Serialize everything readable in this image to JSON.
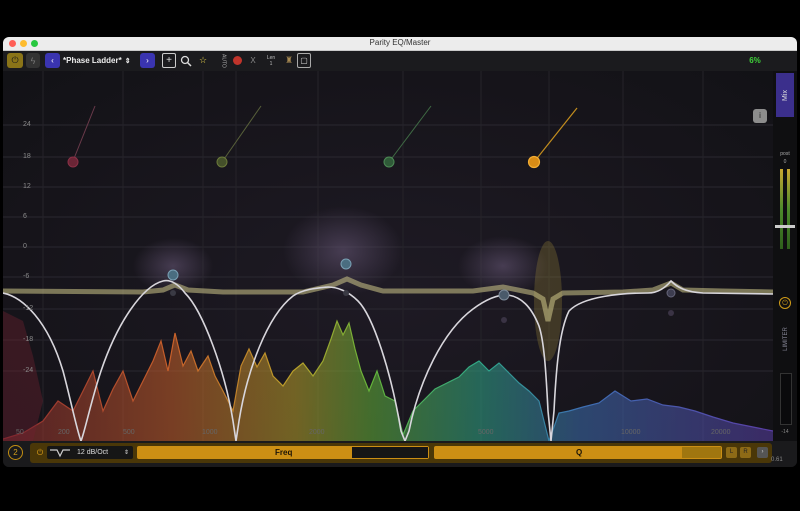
{
  "window": {
    "title": "Parity EQ/Master"
  },
  "toolbar": {
    "preset_name": "*Phase Ladder*",
    "prev_icon": "‹",
    "next_icon": "›",
    "auto_label": "AUTO",
    "len_label": "Len",
    "len_value": "1",
    "x_label": "X",
    "cpu": "6%"
  },
  "eq": {
    "db_labels": [
      "24",
      "18",
      "12",
      "6",
      "0",
      "-6",
      "-12",
      "-18",
      "-24"
    ],
    "freq_labels": [
      "50",
      "200",
      "500",
      "1000",
      "2000",
      "5000",
      "10000",
      "20000"
    ]
  },
  "side": {
    "mix_label": "Mix",
    "post_label": "post",
    "post_value": "0",
    "limiter_label": "LIMITER",
    "limiter_value": "-14"
  },
  "band": {
    "number": "2",
    "slope": "12 dB/Oct",
    "freq_label": "Freq",
    "q_label": "Q",
    "left_label": "L",
    "right_label": "R",
    "version": "0.61"
  }
}
